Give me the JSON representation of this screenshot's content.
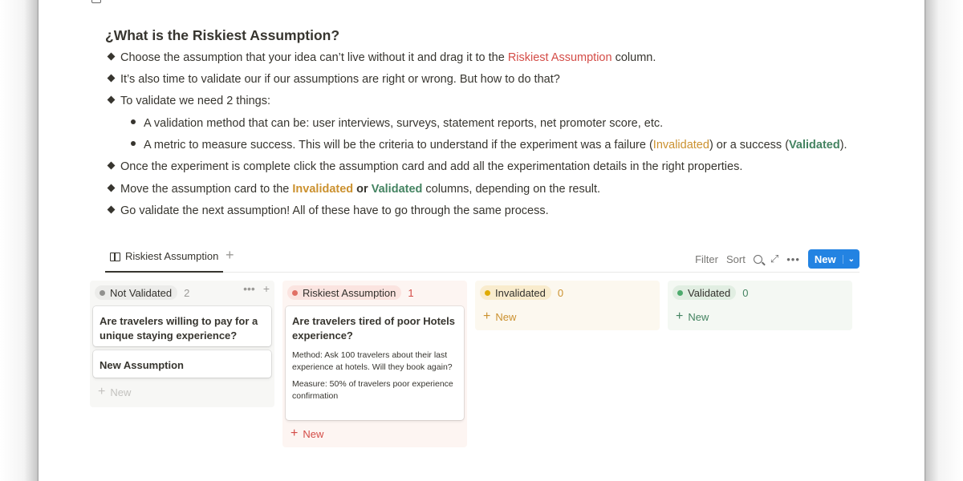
{
  "page": {
    "heading": "¿What is the Riskiest Assumption?",
    "bullets": {
      "b1_pre": "Choose the assumption that your idea can’t live without it and drag it to the ",
      "b1_hl": "Riskiest Assumption",
      "b1_post": " column.",
      "b2": "It’s also time to validate our if our assumptions are right or wrong. But how to do that?",
      "b3": "To validate we need 2 things:",
      "s1": "A validation method that can be: user interviews, surveys, statement reports, net promoter score, etc.",
      "s2_pre": "A metric to measure success. This will be the criteria to understand if the experiment was a failure (",
      "s2_inv": "Invalidated",
      "s2_mid": ") or a success (",
      "s2_val": "Validated",
      "s2_post": ").",
      "b4": "Once the experiment is complete click the assumption card and add all the experimentation details in the right properties.",
      "b5_pre": "Move the assumption card to the ",
      "b5_inv": "Invalidated",
      "b5_or": " or ",
      "b5_val": "Validated",
      "b5_post": " columns, depending on the result.",
      "b6": "Go validate the next assumption! All of these have to go through the same process."
    }
  },
  "view": {
    "tab_label": "Riskiest Assumption",
    "add_view_icon": "plus-icon",
    "filter_label": "Filter",
    "sort_label": "Sort",
    "new_label": "New",
    "more_glyph": "•••",
    "plus_glyph": "+",
    "expand_glyph": "⤢",
    "chevron_glyph": "⌄"
  },
  "board": {
    "columns": [
      {
        "name": "Not Validated",
        "count": "2",
        "color": "#91918e",
        "bg": "#f7f7f5",
        "pill_bg": "#ececea",
        "text_color": "#9b9a97",
        "cards": [
          {
            "title": "Are travelers willing to pay for a unique staying experience?"
          },
          {
            "title": "New Assumption"
          }
        ],
        "new_label": "New"
      },
      {
        "name": "Riskiest Assumption",
        "count": "1",
        "color": "#e16f64",
        "bg": "#fdf5f2",
        "pill_bg": "#fbe4e0",
        "text_color": "#d44c47",
        "cards": [
          {
            "title": "Are travelers tired of poor Hotels experience?",
            "method": "Method: Ask 100 travelers about their last experience at hotels. Will they book again?",
            "measure": "Measure: 50% of travelers poor experience confirmation"
          }
        ],
        "new_label": "New"
      },
      {
        "name": "Invalidated",
        "count": "0",
        "color": "#dfab01",
        "bg": "#fcf8ef",
        "pill_bg": "#f9eccd",
        "text_color": "#cb912f",
        "cards": [],
        "new_label": "New"
      },
      {
        "name": "Validated",
        "count": "0",
        "color": "#4dab6d",
        "bg": "#f4f8f3",
        "pill_bg": "#e1eee2",
        "text_color": "#448361",
        "cards": [],
        "new_label": "New"
      }
    ]
  }
}
